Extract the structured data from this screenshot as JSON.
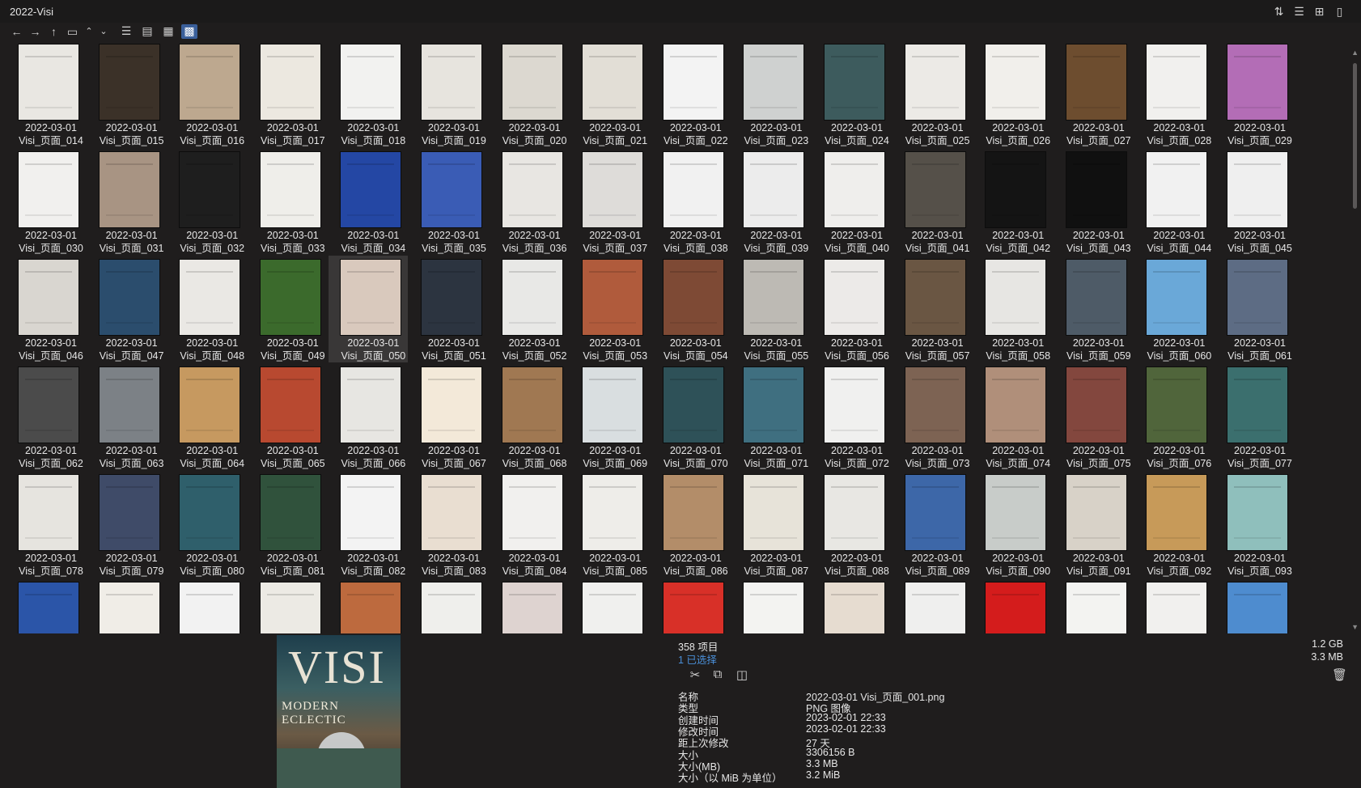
{
  "window": {
    "title": "2022-Visi"
  },
  "titlebar_icons": [
    "sort-icon",
    "list-view-icon",
    "new-tab-icon",
    "clipboard-icon"
  ],
  "toolbar": {
    "back_icon": "←",
    "forward_icon": "→",
    "up_icon": "↑",
    "folder_icon": "▭",
    "chevron_up": "⌃",
    "chevron_down": "⌄"
  },
  "grid": {
    "selected_index": 36,
    "captions": [
      [
        "2022-03-01",
        "Visi_页面_014"
      ],
      [
        "2022-03-01",
        "Visi_页面_015"
      ],
      [
        "2022-03-01",
        "Visi_页面_016"
      ],
      [
        "2022-03-01",
        "Visi_页面_017"
      ],
      [
        "2022-03-01",
        "Visi_页面_018"
      ],
      [
        "2022-03-01",
        "Visi_页面_019"
      ],
      [
        "2022-03-01",
        "Visi_页面_020"
      ],
      [
        "2022-03-01",
        "Visi_页面_021"
      ],
      [
        "2022-03-01",
        "Visi_页面_022"
      ],
      [
        "2022-03-01",
        "Visi_页面_023"
      ],
      [
        "2022-03-01",
        "Visi_页面_024"
      ],
      [
        "2022-03-01",
        "Visi_页面_025"
      ],
      [
        "2022-03-01",
        "Visi_页面_026"
      ],
      [
        "2022-03-01",
        "Visi_页面_027"
      ],
      [
        "2022-03-01",
        "Visi_页面_028"
      ],
      [
        "2022-03-01",
        "Visi_页面_029"
      ],
      [
        "2022-03-01",
        "Visi_页面_030"
      ],
      [
        "2022-03-01",
        "Visi_页面_031"
      ],
      [
        "2022-03-01",
        "Visi_页面_032"
      ],
      [
        "2022-03-01",
        "Visi_页面_033"
      ],
      [
        "2022-03-01",
        "Visi_页面_034"
      ],
      [
        "2022-03-01",
        "Visi_页面_035"
      ],
      [
        "2022-03-01",
        "Visi_页面_036"
      ],
      [
        "2022-03-01",
        "Visi_页面_037"
      ],
      [
        "2022-03-01",
        "Visi_页面_038"
      ],
      [
        "2022-03-01",
        "Visi_页面_039"
      ],
      [
        "2022-03-01",
        "Visi_页面_040"
      ],
      [
        "2022-03-01",
        "Visi_页面_041"
      ],
      [
        "2022-03-01",
        "Visi_页面_042"
      ],
      [
        "2022-03-01",
        "Visi_页面_043"
      ],
      [
        "2022-03-01",
        "Visi_页面_044"
      ],
      [
        "2022-03-01",
        "Visi_页面_045"
      ],
      [
        "2022-03-01",
        "Visi_页面_046"
      ],
      [
        "2022-03-01",
        "Visi_页面_047"
      ],
      [
        "2022-03-01",
        "Visi_页面_048"
      ],
      [
        "2022-03-01",
        "Visi_页面_049"
      ],
      [
        "2022-03-01",
        "Visi_页面_050"
      ],
      [
        "2022-03-01",
        "Visi_页面_051"
      ],
      [
        "2022-03-01",
        "Visi_页面_052"
      ],
      [
        "2022-03-01",
        "Visi_页面_053"
      ],
      [
        "2022-03-01",
        "Visi_页面_054"
      ],
      [
        "2022-03-01",
        "Visi_页面_055"
      ],
      [
        "2022-03-01",
        "Visi_页面_056"
      ],
      [
        "2022-03-01",
        "Visi_页面_057"
      ],
      [
        "2022-03-01",
        "Visi_页面_058"
      ],
      [
        "2022-03-01",
        "Visi_页面_059"
      ],
      [
        "2022-03-01",
        "Visi_页面_060"
      ],
      [
        "2022-03-01",
        "Visi_页面_061"
      ],
      [
        "2022-03-01",
        "Visi_页面_062"
      ],
      [
        "2022-03-01",
        "Visi_页面_063"
      ],
      [
        "2022-03-01",
        "Visi_页面_064"
      ],
      [
        "2022-03-01",
        "Visi_页面_065"
      ],
      [
        "2022-03-01",
        "Visi_页面_066"
      ],
      [
        "2022-03-01",
        "Visi_页面_067"
      ],
      [
        "2022-03-01",
        "Visi_页面_068"
      ],
      [
        "2022-03-01",
        "Visi_页面_069"
      ],
      [
        "2022-03-01",
        "Visi_页面_070"
      ],
      [
        "2022-03-01",
        "Visi_页面_071"
      ],
      [
        "2022-03-01",
        "Visi_页面_072"
      ],
      [
        "2022-03-01",
        "Visi_页面_073"
      ],
      [
        "2022-03-01",
        "Visi_页面_074"
      ],
      [
        "2022-03-01",
        "Visi_页面_075"
      ],
      [
        "2022-03-01",
        "Visi_页面_076"
      ],
      [
        "2022-03-01",
        "Visi_页面_077"
      ],
      [
        "2022-03-01",
        "Visi_页面_078"
      ],
      [
        "2022-03-01",
        "Visi_页面_079"
      ],
      [
        "2022-03-01",
        "Visi_页面_080"
      ],
      [
        "2022-03-01",
        "Visi_页面_081"
      ],
      [
        "2022-03-01",
        "Visi_页面_082"
      ],
      [
        "2022-03-01",
        "Visi_页面_083"
      ],
      [
        "2022-03-01",
        "Visi_页面_084"
      ],
      [
        "2022-03-01",
        "Visi_页面_085"
      ],
      [
        "2022-03-01",
        "Visi_页面_086"
      ],
      [
        "2022-03-01",
        "Visi_页面_087"
      ],
      [
        "2022-03-01",
        "Visi_页面_088"
      ],
      [
        "2022-03-01",
        "Visi_页面_089"
      ],
      [
        "2022-03-01",
        "Visi_页面_090"
      ],
      [
        "2022-03-01",
        "Visi_页面_091"
      ],
      [
        "2022-03-01",
        "Visi_页面_092"
      ],
      [
        "2022-03-01",
        "Visi_页面_093"
      ],
      [
        "",
        ""
      ],
      [
        "",
        ""
      ],
      [
        "",
        ""
      ],
      [
        "",
        ""
      ],
      [
        "",
        ""
      ],
      [
        "",
        ""
      ],
      [
        "",
        ""
      ],
      [
        "",
        ""
      ],
      [
        "",
        ""
      ],
      [
        "",
        ""
      ],
      [
        "",
        ""
      ],
      [
        "",
        ""
      ],
      [
        "",
        ""
      ],
      [
        "",
        ""
      ],
      [
        "",
        ""
      ],
      [
        "",
        ""
      ]
    ],
    "thumb_colors": [
      "#e9e7e2",
      "#3b3128",
      "#bda88f",
      "#ece8e0",
      "#f2f2f0",
      "#e7e4de",
      "#dcd8d0",
      "#e2ded6",
      "#f3f3f3",
      "#cfd1d0",
      "#3d5b5d",
      "#eceae6",
      "#f1efeb",
      "#6d4d2f",
      "#f1f0ee",
      "#b36db6",
      "#f1f0ee",
      "#a89483",
      "#1e1e1e",
      "#efeeea",
      "#2447a4",
      "#3a5cb5",
      "#e8e6e2",
      "#dedcd9",
      "#f1f1f1",
      "#ececec",
      "#efeeec",
      "#555049",
      "#141414",
      "#101010",
      "#f1f1f1",
      "#efefef",
      "#d9d6d0",
      "#2b4d6d",
      "#eae8e4",
      "#3b6a2c",
      "#d9c9bd",
      "#2c3440",
      "#e8e8e6",
      "#b05b3c",
      "#7e4a35",
      "#bdbab4",
      "#eceae8",
      "#6a5643",
      "#e7e6e3",
      "#4e5b67",
      "#6aa8d8",
      "#5d6c84",
      "#4b4b4b",
      "#7c8186",
      "#c69960",
      "#b84930",
      "#e7e6e2",
      "#f3e9d9",
      "#a07852",
      "#d9dee0",
      "#2e5158",
      "#3f6f80",
      "#f0f0ef",
      "#7d6353",
      "#b08f7a",
      "#83473e",
      "#50653b",
      "#3b6f6e",
      "#e6e4df",
      "#3f4b68",
      "#2f5f6b",
      "#30523c",
      "#f3f3f3",
      "#e9ded1",
      "#f1f0ee",
      "#eeede9",
      "#b38d69",
      "#e7e3d9",
      "#e8e7e3",
      "#3d67a8",
      "#c8ccc9",
      "#d8d2c8",
      "#c79a59",
      "#8fbfbc",
      "#2b55a8",
      "#f0ede7",
      "#f2f2f2",
      "#eceae4",
      "#bd6a3e",
      "#efefec",
      "#ded3d0",
      "#f0f0ee",
      "#d83028",
      "#f3f3f1",
      "#e6dcd0",
      "#efefee",
      "#d41c1c",
      "#f3f3f1",
      "#f1f0ee",
      "#4e8ccf"
    ]
  },
  "info": {
    "count": "358 项目",
    "selected": "1 已选择",
    "total_size": "1.2 GB",
    "selected_size": "3.3 MB",
    "actions": [
      "cut-icon",
      "copy-icon",
      "compare-icon"
    ],
    "properties": [
      {
        "label": "名称",
        "value": "2022-03-01 Visi_页面_001.png"
      },
      {
        "label": "类型",
        "value": "PNG 图像"
      },
      {
        "label": "创建时间",
        "value": "2023-02-01  22:33"
      },
      {
        "label": "修改时间",
        "value": "2023-02-01  22:33"
      },
      {
        "label": "距上次修改",
        "value": "27 天"
      },
      {
        "label": "大小",
        "value": "3306156 B"
      },
      {
        "label": "大小(MB)",
        "value": "3.3 MB"
      },
      {
        "label": "大小（以 MiB 为单位）",
        "value": "3.2 MiB"
      }
    ]
  },
  "preview": {
    "cover_title": "VISI",
    "cover_subtitle": "MODERN ECLECTIC"
  }
}
